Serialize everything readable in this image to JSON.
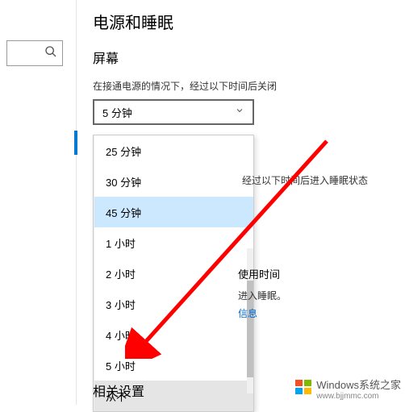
{
  "page": {
    "title": "电源和睡眠",
    "section_screen": "屏幕",
    "screen_label": "在接通电源的情况下，经过以下时间后关闭",
    "screen_value": "5 分钟",
    "sleep_label": "经过以下时间后进入睡眠状态",
    "related_settings": "相关设置"
  },
  "dropdown": {
    "options": [
      "25 分钟",
      "30 分钟",
      "45 分钟",
      "1 小时",
      "2 小时",
      "3 小时",
      "4 小时",
      "5 小时",
      "从不"
    ],
    "highlighted_index": 2,
    "hovered_index": 8
  },
  "related": {
    "heading": "使用时间",
    "text": "进入睡眠。",
    "link": "信息"
  },
  "watermark": {
    "brand": "Windows系统之家",
    "url": "www.bjjmmc.com"
  }
}
